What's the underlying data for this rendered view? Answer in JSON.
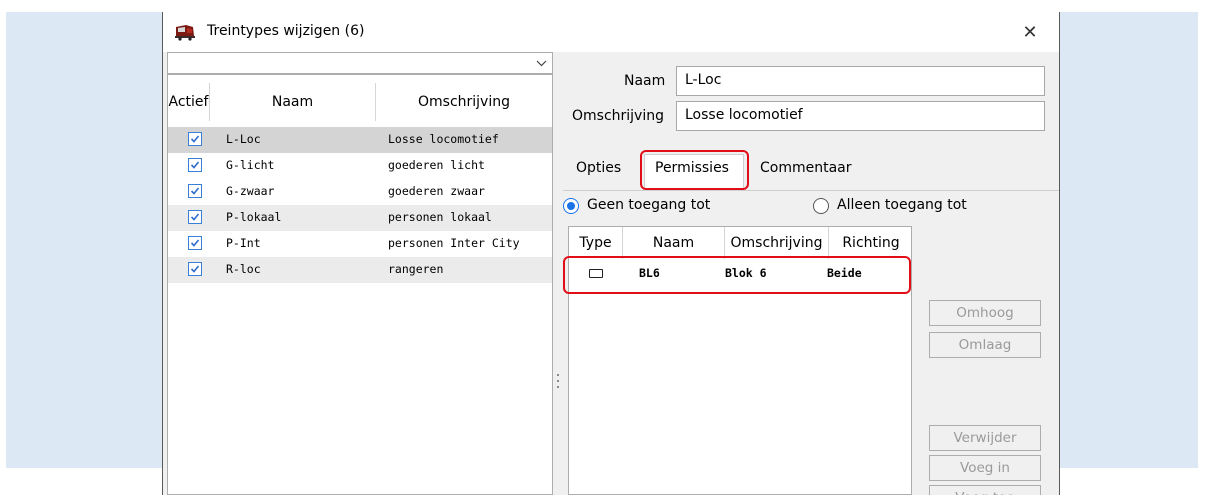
{
  "window": {
    "title": "Treintypes wijzigen (6)",
    "close_glyph": "✕"
  },
  "filter": {
    "value": ""
  },
  "list": {
    "headers": {
      "active": "Actief",
      "name": "Naam",
      "description": "Omschrijving"
    },
    "rows": [
      {
        "checked": true,
        "name": "L-Loc",
        "description": "Losse locomotief",
        "state": "selected"
      },
      {
        "checked": true,
        "name": "G-licht",
        "description": "goederen licht",
        "state": ""
      },
      {
        "checked": true,
        "name": "G-zwaar",
        "description": "goederen zwaar",
        "state": ""
      },
      {
        "checked": true,
        "name": "P-lokaal",
        "description": "personen lokaal",
        "state": "alt"
      },
      {
        "checked": true,
        "name": "P-Int",
        "description": "personen Inter City",
        "state": ""
      },
      {
        "checked": true,
        "name": "R-loc",
        "description": "rangeren",
        "state": "alt"
      }
    ]
  },
  "form": {
    "name_label": "Naam",
    "name_value": "L-Loc",
    "description_label": "Omschrijving",
    "description_value": "Losse locomotief"
  },
  "tabs": {
    "options": "Opties",
    "permissions": "Permissies",
    "comments": "Commentaar",
    "active": "permissions"
  },
  "access": {
    "no_access_label": "Geen toegang tot",
    "only_access_label": "Alleen toegang tot",
    "selected": "no_access"
  },
  "permissions_table": {
    "headers": {
      "type": "Type",
      "name": "Naam",
      "description": "Omschrijving",
      "direction": "Richting"
    },
    "rows": [
      {
        "type_icon": "block-icon",
        "name": "BL6",
        "description": "Blok 6",
        "direction": "Beide"
      }
    ]
  },
  "buttons": {
    "up": "Omhoog",
    "down": "Omlaag",
    "delete": "Verwijder",
    "insert": "Voeg in",
    "add": "Voeg toe"
  },
  "colors": {
    "highlight": "#e20e17",
    "accent": "#1a73e8",
    "checkbox": "#3a7fd6"
  }
}
